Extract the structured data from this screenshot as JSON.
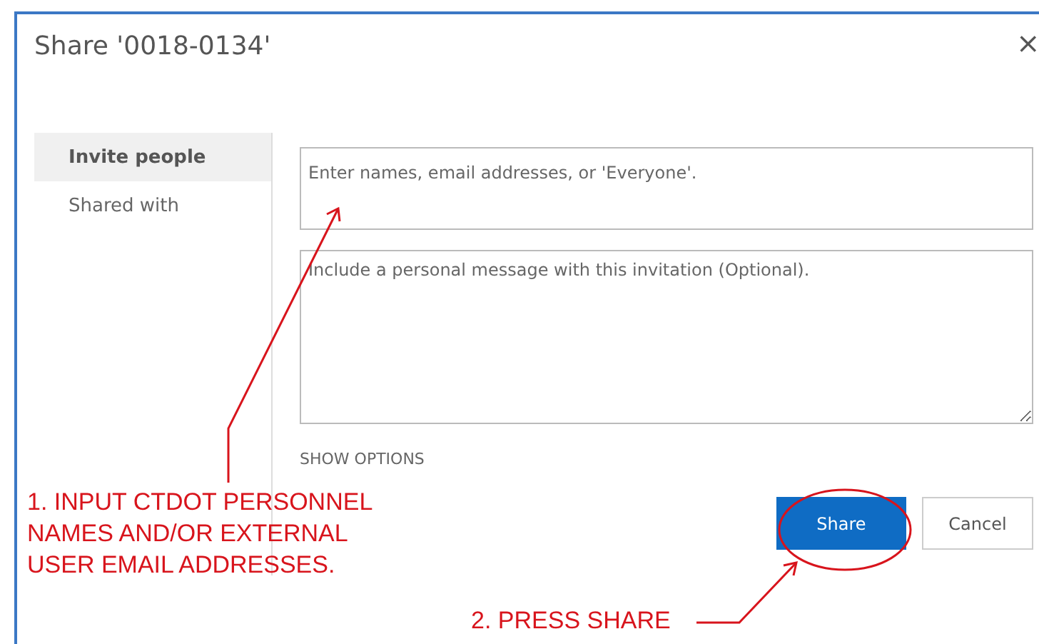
{
  "dialog": {
    "title": "Share '0018-0134'",
    "close": "×"
  },
  "tabs": [
    {
      "label": "Invite people",
      "selected": true
    },
    {
      "label": "Shared with",
      "selected": false
    }
  ],
  "people_field": {
    "placeholder": "Enter names, email addresses, or 'Everyone'."
  },
  "message_field": {
    "placeholder": "Include a personal message with this invitation (Optional)."
  },
  "show_options": "SHOW OPTIONS",
  "buttons": [
    {
      "label": "Share",
      "kind": "primary"
    },
    {
      "label": "Cancel",
      "kind": "secondary"
    }
  ],
  "annotations": [
    {
      "text": "1. INPUT CTDOT PERSONNEL\nNAMES AND/OR EXTERNAL\nUSER EMAIL ADDRESSES.",
      "kind": "input"
    },
    {
      "text": "2. PRESS SHARE",
      "kind": "share"
    }
  ]
}
